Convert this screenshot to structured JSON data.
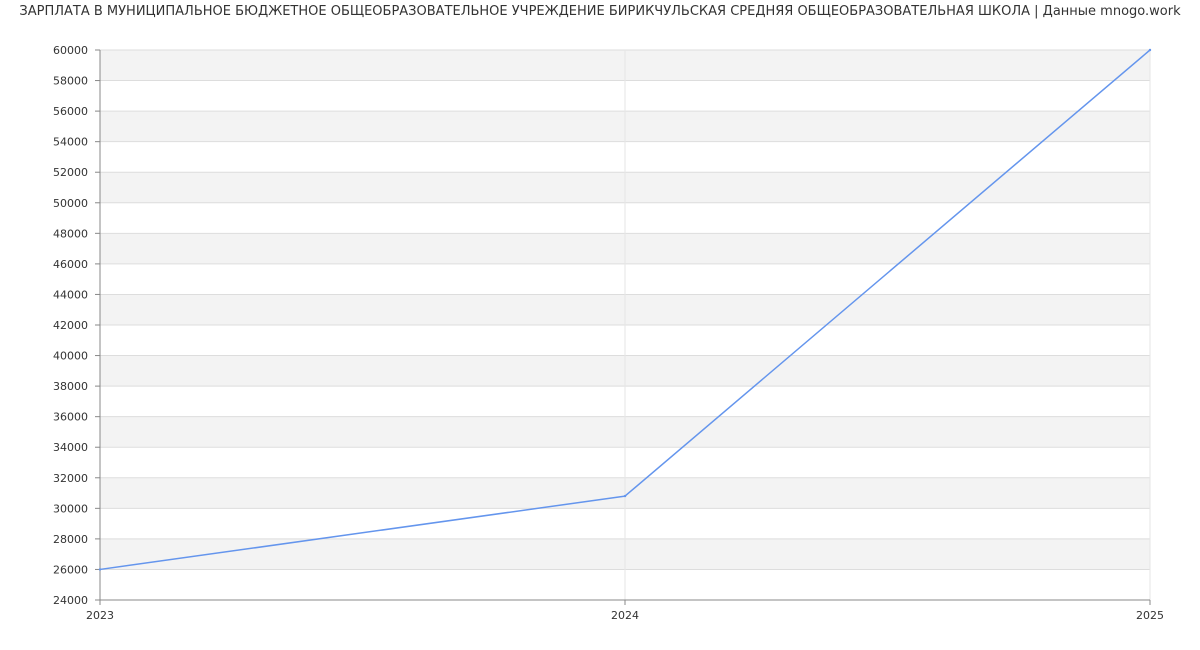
{
  "chart_data": {
    "type": "line",
    "title": "ЗАРПЛАТА В МУНИЦИПАЛЬНОЕ БЮДЖЕТНОЕ ОБЩЕОБРАЗОВАТЕЛЬНОЕ УЧРЕЖДЕНИЕ БИРИКЧУЛЬСКАЯ СРЕДНЯЯ ОБЩЕОБРАЗОВАТЕЛЬНАЯ ШКОЛА | Данные mnogo.work",
    "xlabel": "",
    "ylabel": "",
    "x": [
      "2023",
      "2024",
      "2025"
    ],
    "series": [
      {
        "values": [
          26000,
          30800,
          60000
        ],
        "color": "#6495ED"
      }
    ],
    "ylim": [
      24000,
      60000
    ],
    "ytick_step": 2000,
    "grid": true,
    "band_colors": [
      "#f3f3f3",
      "#ffffff"
    ],
    "legend": "none"
  }
}
